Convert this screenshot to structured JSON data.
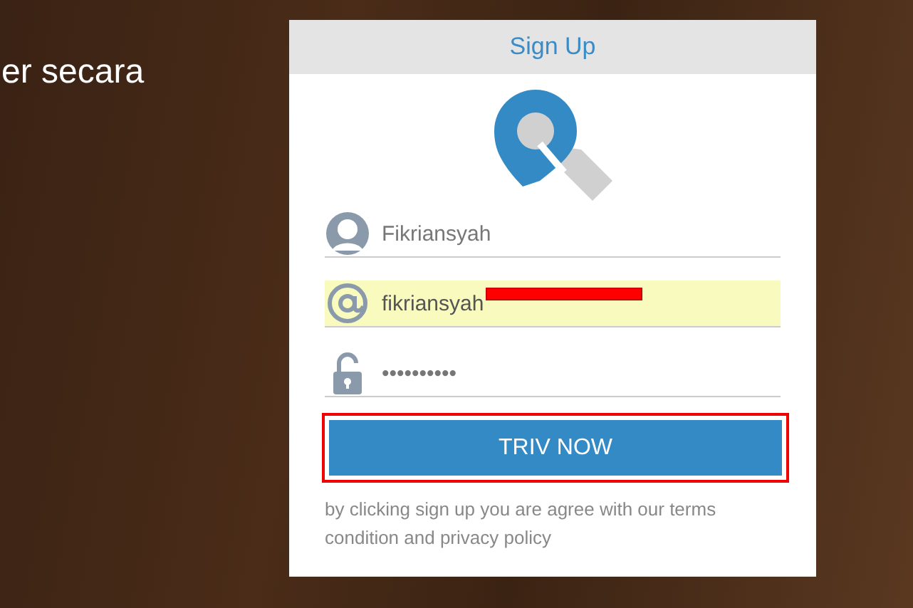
{
  "headline": "er secara",
  "card": {
    "title": "Sign Up",
    "fields": [
      {
        "kind": "person",
        "value": "Fikriansyah",
        "autofilled": false,
        "redacted": false
      },
      {
        "kind": "at",
        "value": "fikriansyah",
        "autofilled": true,
        "redacted": true
      },
      {
        "kind": "lock",
        "value": "••••••••••",
        "autofilled": false,
        "redacted": false
      }
    ],
    "button": {
      "label": "TRIV NOW",
      "highlighted": true
    },
    "note": "by clicking sign up you are agree with our terms condition and privacy policy"
  }
}
